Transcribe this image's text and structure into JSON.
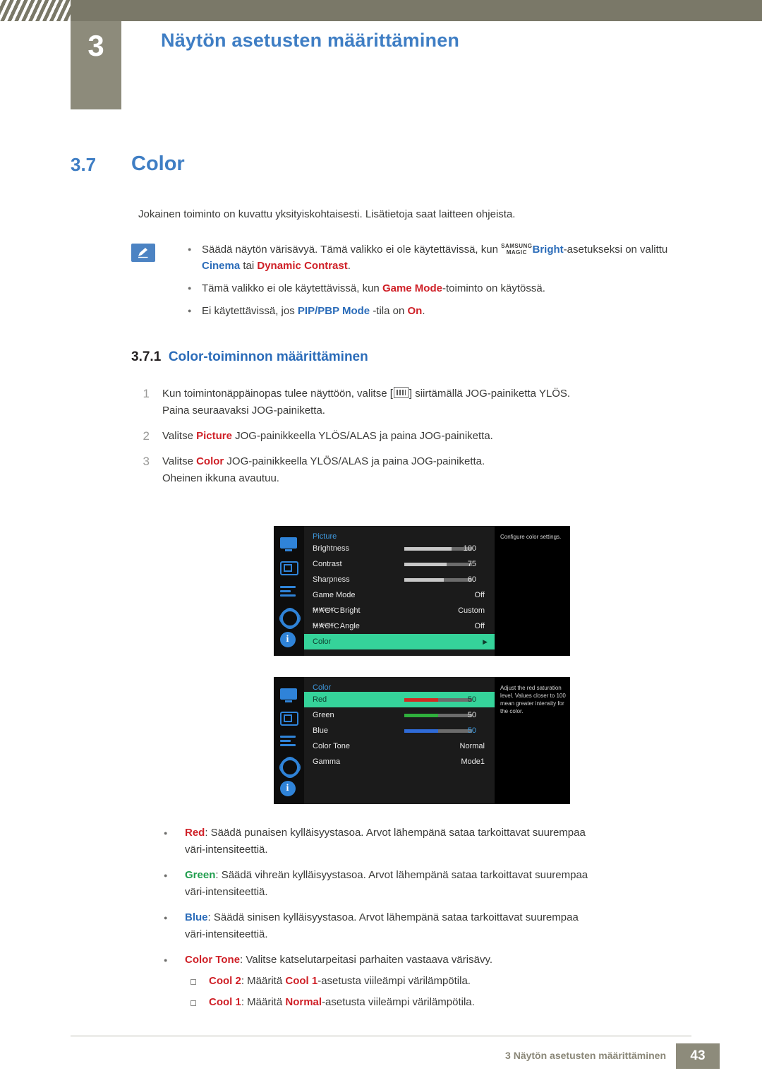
{
  "header": {
    "chapter_number": "3",
    "chapter_title": "Näytön asetusten määrittäminen"
  },
  "section": {
    "number": "3.7",
    "title": "Color"
  },
  "intro": "Jokainen toiminto on kuvattu yksityiskohtaisesti. Lisätietoja saat laitteen ohjeista.",
  "notes": [
    {
      "pre": "Säädä näytön värisävyä. Tämä valikko ei ole käytettävissä, kun ",
      "magic_top": "SAMSUNG",
      "magic_bottom": "MAGIC",
      "bright": "Bright",
      "post": "-asetukseksi on valittu ",
      "line2_a": "Cinema",
      "line2_mid": " tai ",
      "line2_b": "Dynamic Contrast",
      "line2_end": "."
    },
    {
      "pre": "Tämä valikko ei ole käytettävissä, kun ",
      "hl": "Game Mode",
      "post": "-toiminto on käytössä."
    },
    {
      "pre": "Ei käytettävissä, jos ",
      "hl": "PIP/PBP Mode ",
      "mid": "-tila on ",
      "hl2": "On",
      "post": "."
    }
  ],
  "subsection": {
    "number": "3.7.1",
    "title": "Color-toiminnon määrittäminen"
  },
  "steps": [
    {
      "num": "1",
      "text_a": "Kun toimintonäppäinopas tulee näyttöön, valitse [",
      "text_b": "] siirtämällä JOG-painiketta YLÖS.",
      "sub": "Paina seuraavaksi JOG-painiketta."
    },
    {
      "num": "2",
      "text_a": "Valitse ",
      "hl": "Picture",
      "text_b": " JOG-painikkeella YLÖS/ALAS ja paina JOG-painiketta."
    },
    {
      "num": "3",
      "text_a": "Valitse ",
      "hl": "Color",
      "text_b": " JOG-painikkeella YLÖS/ALAS ja paina JOG-painiketta.",
      "sub": "Oheinen ikkuna avautuu."
    }
  ],
  "osd1": {
    "title": "Picture",
    "help": "Configure color settings.",
    "rows": [
      {
        "label": "Brightness",
        "value": "100",
        "bar": 70,
        "bar_color": "#c8c8c8",
        "type": "bar"
      },
      {
        "label": "Contrast",
        "value": "75",
        "bar": 62,
        "bar_color": "#c8c8c8",
        "type": "bar"
      },
      {
        "label": "Sharpness",
        "value": "60",
        "bar": 58,
        "bar_color": "#c8c8c8",
        "type": "bar"
      },
      {
        "label": "Game Mode",
        "value": "Off",
        "type": "text"
      },
      {
        "label": "MAGICBright",
        "value": "Custom",
        "type": "magic",
        "tiny": "SAMSUNG",
        "mg": "MAGIC",
        "suffix": "Bright"
      },
      {
        "label": "MAGICAngle",
        "value": "Off",
        "type": "magic",
        "tiny": "SAMSUNG",
        "mg": "MAGIC",
        "suffix": "Angle"
      },
      {
        "label": "Color",
        "value": "",
        "type": "selected"
      }
    ]
  },
  "osd2": {
    "title": "Color",
    "help": "Adjust the red saturation level. Values closer to 100 mean greater intensity for the color.",
    "rows": [
      {
        "label": "Red",
        "value": "50",
        "bar": 50,
        "bar_color": "#d12a22",
        "type": "selected-bar"
      },
      {
        "label": "Green",
        "value": "50",
        "bar": 50,
        "bar_color": "#2fb03c",
        "type": "bar"
      },
      {
        "label": "Blue",
        "value": "50",
        "bar": 50,
        "bar_color": "#2f6bd8",
        "type": "bar",
        "value_color": "#3f9ae0"
      },
      {
        "label": "Color Tone",
        "value": "Normal",
        "type": "text"
      },
      {
        "label": "Gamma",
        "value": "Mode1",
        "type": "text"
      }
    ]
  },
  "lower_bullets": [
    {
      "hl": "Red",
      "text": ": Säädä punaisen kylläisyystasoa. Arvot lähempänä sataa tarkoittavat suurempaa",
      "line2": "väri-intensiteettiä.",
      "hl_color": "#cf2027"
    },
    {
      "hl": "Green",
      "text": ": Säädä vihreän kylläisyystasoa. Arvot lähempänä sataa tarkoittavat suurempaa",
      "line2": "väri-intensiteettiä.",
      "hl_color": "#1f9d4d"
    },
    {
      "hl": "Blue",
      "text": ": Säädä sinisen kylläisyystasoa. Arvot lähempänä sataa tarkoittavat suurempaa",
      "line2": "väri-intensiteettiä.",
      "hl_color": "#2b6cb9"
    },
    {
      "hl": "Color Tone",
      "text": ": Valitse katselutarpeitasi parhaiten vastaava värisävy.",
      "hl_color": "#cf2027"
    }
  ],
  "sub_bullets": [
    {
      "hl": "Cool 2",
      "mid": ": Määritä ",
      "hl2": "Cool 1",
      "post": "-asetusta viileämpi värilämpötila."
    },
    {
      "hl": "Cool 1",
      "mid": ": Määritä ",
      "hl2": "Normal",
      "post": "-asetusta viileämpi värilämpötila."
    }
  ],
  "footer": {
    "text": "3 Näytön asetusten määrittäminen",
    "page": "43"
  }
}
